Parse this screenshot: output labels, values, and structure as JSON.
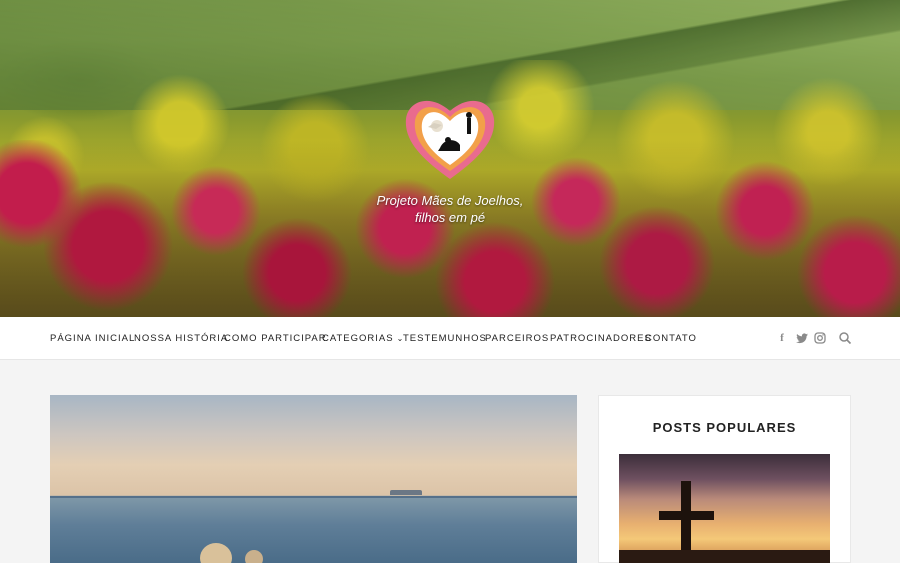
{
  "site": {
    "title_line1": "Projeto Mães de Joelhos,",
    "title_line2": "filhos em pé",
    "logo_icon": "heart-logo-icon"
  },
  "nav": {
    "items": [
      {
        "label": "PÁGINA INICIAL"
      },
      {
        "label": "NOSSA HISTÓRIA"
      },
      {
        "label": "COMO PARTICIPAR"
      },
      {
        "label": "CATEGORIAS",
        "has_dropdown": true
      },
      {
        "label": "TESTEMUNHOS"
      },
      {
        "label": "PARCEIROS"
      },
      {
        "label": "PATROCINADORES"
      },
      {
        "label": "CONTATO"
      }
    ],
    "social_icons": [
      "facebook-icon",
      "twitter-icon",
      "instagram-icon"
    ],
    "search_icon": "search-icon"
  },
  "sidebar": {
    "widget_title": "POSTS POPULARES"
  },
  "colors": {
    "nav_bg": "#ffffff",
    "page_bg": "#f4f4f4",
    "text": "#222222",
    "icon_gray": "#8a8a8a"
  }
}
